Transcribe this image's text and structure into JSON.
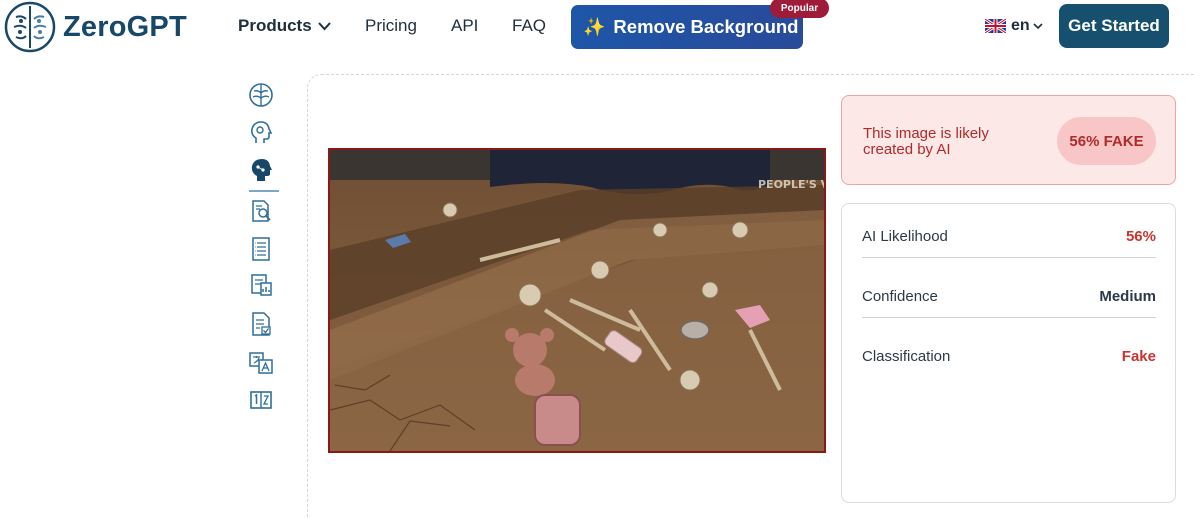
{
  "header": {
    "logo_text": "ZeroGPT",
    "nav": {
      "products": "Products",
      "pricing": "Pricing",
      "api": "API",
      "faq": "FAQ"
    },
    "remove_bg_label": "Remove Background",
    "remove_bg_badge": "Popular",
    "language": "en",
    "get_started": "Get Started"
  },
  "tools": [
    {
      "icon": "brain-icon"
    },
    {
      "icon": "head-gears-icon"
    },
    {
      "icon": "ai-head-icon",
      "active": true
    },
    {
      "icon": "document-search-icon"
    },
    {
      "icon": "document-list-icon"
    },
    {
      "icon": "document-analysis-icon"
    },
    {
      "icon": "document-check-icon"
    },
    {
      "icon": "translate-icon"
    },
    {
      "icon": "word-counter-icon"
    }
  ],
  "image": {
    "watermark": "PEOPLE'S VOICE"
  },
  "verdict": {
    "text": "This image is likely created by AI",
    "pill": "56% FAKE"
  },
  "stats": [
    {
      "label": "AI Likelihood",
      "value": "56%"
    },
    {
      "label": "Confidence",
      "value": "Medium"
    },
    {
      "label": "Classification",
      "value": "Fake"
    }
  ],
  "colors": {
    "brand": "#17486a",
    "accent_blue": "#1e56a8",
    "fake_red": "#c8342f",
    "verdict_bg": "#fde8e8"
  }
}
